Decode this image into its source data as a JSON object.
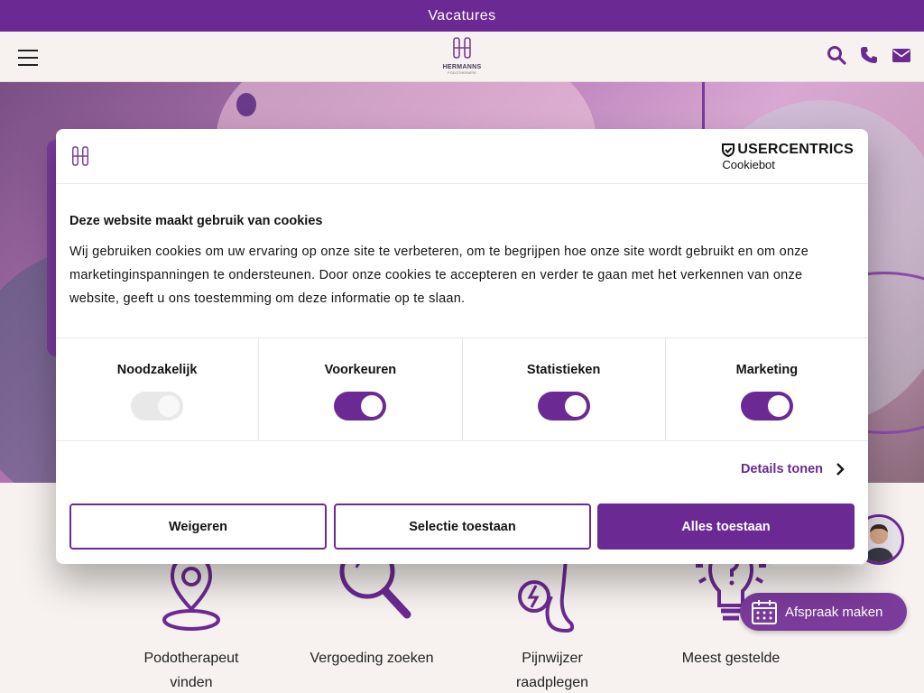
{
  "topbar": {
    "label": "Vacatures"
  },
  "header": {
    "logo": {
      "brand": "HERMANNS",
      "tagline": "PODOTHERAPIE"
    },
    "icons": [
      "search-icon",
      "phone-icon",
      "mail-icon"
    ]
  },
  "features": [
    {
      "label": "Podotherapeut vinden",
      "icon": "location-pin-icon"
    },
    {
      "label": "Vergoeding zoeken",
      "icon": "magnifier-icon"
    },
    {
      "label": "Pijnwijzer raadplegen",
      "icon": "foot-pain-icon"
    },
    {
      "label": "Meest gestelde",
      "icon": "lightbulb-question-icon"
    }
  ],
  "appointment": {
    "label": "Afspraak maken"
  },
  "cookie": {
    "provider_brand": "USERCENTRICS",
    "provider_product": "Cookiebot",
    "title": "Deze website maakt gebruik van cookies",
    "body": "Wij gebruiken cookies om uw ervaring op onze site te verbeteren, om te begrijpen hoe onze site wordt gebruikt en om onze marketinginspanningen te ondersteunen. Door onze cookies te accepteren en verder te gaan met het verkennen van onze website, geeft u ons toestemming om deze informatie op te slaan.",
    "categories": [
      {
        "label": "Noodzakelijk",
        "enabled": true,
        "locked": true
      },
      {
        "label": "Voorkeuren",
        "enabled": true,
        "locked": false
      },
      {
        "label": "Statistieken",
        "enabled": true,
        "locked": false
      },
      {
        "label": "Marketing",
        "enabled": true,
        "locked": false
      }
    ],
    "details_label": "Details tonen",
    "buttons": {
      "reject": "Weigeren",
      "allow_selection": "Selectie toestaan",
      "allow_all": "Alles toestaan"
    }
  },
  "colors": {
    "brand": "#6b2a93",
    "background": "#f7f2ef"
  }
}
